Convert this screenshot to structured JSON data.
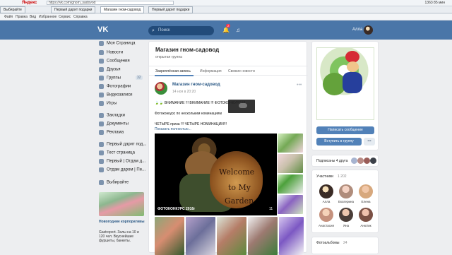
{
  "browser": {
    "brand": "Яндекс",
    "address": "https://vk.com/gnom_sadovod",
    "tabs": [
      "Выбирайте",
      "Первый дарит подарки",
      "Магазин гном-садовод",
      "Первый дарит подарки"
    ],
    "menu": [
      "Файл",
      "Правка",
      "Вид",
      "Избранное",
      "Сервис",
      "Справка"
    ],
    "status": "1363 85 мин"
  },
  "vk": {
    "logo": "VK",
    "search_placeholder": "Поиск",
    "notifications_count": "2",
    "user_name": "Алла"
  },
  "sidebar": {
    "items": [
      {
        "label": "Моя Страница",
        "icon": "home-icon"
      },
      {
        "label": "Новости",
        "icon": "news-icon"
      },
      {
        "label": "Сообщения",
        "icon": "message-icon"
      },
      {
        "label": "Друзья",
        "icon": "friends-icon"
      },
      {
        "label": "Группы",
        "icon": "groups-icon",
        "count": "32"
      },
      {
        "label": "Фотографии",
        "icon": "photo-icon"
      },
      {
        "label": "Видеозаписи",
        "icon": "video-icon"
      },
      {
        "label": "Игры",
        "icon": "games-icon"
      },
      {
        "label": "Закладки",
        "icon": "bookmark-icon"
      },
      {
        "label": "Документы",
        "icon": "document-icon"
      },
      {
        "label": "Реклама",
        "icon": "ads-icon"
      },
      {
        "label": "Первый дарит под...",
        "icon": "community-icon"
      },
      {
        "label": "Тест страница",
        "icon": "community-icon"
      },
      {
        "label": "Первый | Отдам д...",
        "icon": "community-icon"
      },
      {
        "label": "Отдам даром | Пе...",
        "icon": "community-icon"
      },
      {
        "label": "Выбирайте",
        "icon": "community-icon"
      }
    ],
    "promo": {
      "title": "Новогодние корпоративы",
      "text": "Gastroport. Залы на 10 и 120 чел. Вкуснейшие фуршеты, банкеты."
    }
  },
  "group": {
    "title": "Магазин гном-садовод",
    "subtitle": "открытая группа",
    "tabs": [
      "Закреплённая запись",
      "Информация",
      "Свежие новости"
    ]
  },
  "post": {
    "author": "Магазин гном-садовод",
    "time": "14 ноя в 20:20",
    "lines": [
      "🍃🍃 ВНИМАНИЕ !!! ВНИМАНИЕ !!! ФОТОКОНКУРС !!!",
      "Фотоконкурс по нескольким номинациям",
      "ЧЕТЫРЕ приза !!! ЧЕТЫРЕ НОМИНАЦИИ!!!",
      "Показать полностью..."
    ],
    "media": {
      "sign_lines": [
        "Welcome",
        "to My",
        "Garden"
      ],
      "watermark": "ФОТОКОНКУРС 2016г",
      "count": "11"
    }
  },
  "right": {
    "send_message": "Написать сообщение",
    "join_group": "Вступить в группу",
    "more": "•••",
    "friends_text": "Подписаны 4 друга",
    "members_title": "Участники",
    "members_count": "1 202",
    "members": [
      "Алла",
      "Екатерина",
      "Елена",
      "Анастасия",
      "Яна",
      "Анютик"
    ],
    "photos_title": "Фотоальбомы",
    "photos_count": "24"
  }
}
